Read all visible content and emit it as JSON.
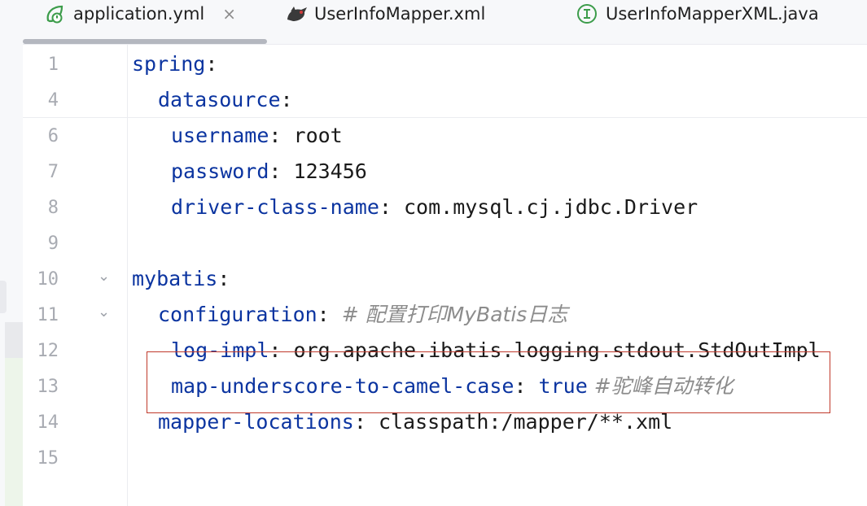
{
  "tabs": [
    {
      "label": "application.yml",
      "icon": "spring-leaf-icon",
      "active": true,
      "close": "×"
    },
    {
      "label": "UserInfoMapper.xml",
      "icon": "mybatis-bird-icon",
      "active": false
    },
    {
      "label": "UserInfoMapperXML.java",
      "icon": "interface-icon",
      "active": false
    }
  ],
  "editor": {
    "lines": [
      {
        "num": "1",
        "key": "spring",
        "sep": ":",
        "value": "",
        "bool": "",
        "comment": ""
      },
      {
        "num": "4",
        "key": "datasource",
        "sep": ":",
        "value": "",
        "bool": "",
        "comment": ""
      },
      {
        "num": "6",
        "key": "username",
        "sep": ": ",
        "value": "root",
        "bool": "",
        "comment": ""
      },
      {
        "num": "7",
        "key": "password",
        "sep": ": ",
        "value": "123456",
        "bool": "",
        "comment": ""
      },
      {
        "num": "8",
        "key": "driver-class-name",
        "sep": ": ",
        "value": "com.mysql.cj.jdbc.Driver",
        "bool": "",
        "comment": ""
      },
      {
        "num": "9",
        "key": "",
        "sep": "",
        "value": "",
        "bool": "",
        "comment": ""
      },
      {
        "num": "10",
        "key": "mybatis",
        "sep": ":",
        "value": "",
        "bool": "",
        "comment": ""
      },
      {
        "num": "11",
        "key": "configuration",
        "sep": ": ",
        "value": "",
        "bool": "",
        "comment": "# 配置打印MyBatis日志"
      },
      {
        "num": "12",
        "key": "log-impl",
        "sep": ": ",
        "value": "org.apache.ibatis.logging.stdout.StdOutImpl",
        "bool": "",
        "comment": ""
      },
      {
        "num": "13",
        "key": "map-underscore-to-camel-case",
        "sep": ": ",
        "value": "",
        "bool": "true",
        "comment": " #驼峰自动转化"
      },
      {
        "num": "14",
        "key": "mapper-locations",
        "sep": ": ",
        "value": "classpath:/mapper/**.xml",
        "bool": "",
        "comment": ""
      },
      {
        "num": "15",
        "key": "",
        "sep": "",
        "value": "",
        "bool": "",
        "comment": ""
      }
    ],
    "fold_marker": "⌄"
  },
  "colors": {
    "key": "#0b34a0",
    "comment": "#8c8c8c",
    "highlight": "#c0392b"
  }
}
